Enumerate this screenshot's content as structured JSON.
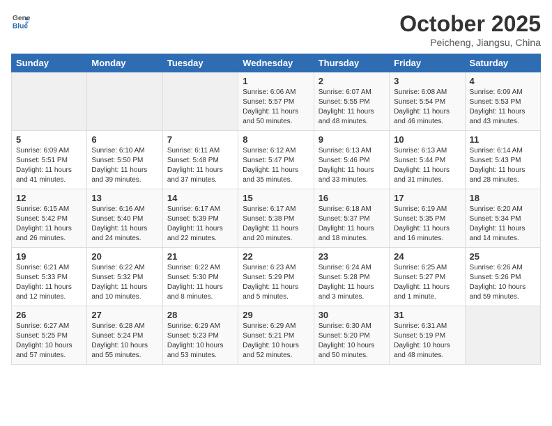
{
  "header": {
    "logo_line1": "General",
    "logo_line2": "Blue",
    "month": "October 2025",
    "location": "Peicheng, Jiangsu, China"
  },
  "weekdays": [
    "Sunday",
    "Monday",
    "Tuesday",
    "Wednesday",
    "Thursday",
    "Friday",
    "Saturday"
  ],
  "weeks": [
    [
      {
        "day": "",
        "info": ""
      },
      {
        "day": "",
        "info": ""
      },
      {
        "day": "",
        "info": ""
      },
      {
        "day": "1",
        "info": "Sunrise: 6:06 AM\nSunset: 5:57 PM\nDaylight: 11 hours\nand 50 minutes."
      },
      {
        "day": "2",
        "info": "Sunrise: 6:07 AM\nSunset: 5:55 PM\nDaylight: 11 hours\nand 48 minutes."
      },
      {
        "day": "3",
        "info": "Sunrise: 6:08 AM\nSunset: 5:54 PM\nDaylight: 11 hours\nand 46 minutes."
      },
      {
        "day": "4",
        "info": "Sunrise: 6:09 AM\nSunset: 5:53 PM\nDaylight: 11 hours\nand 43 minutes."
      }
    ],
    [
      {
        "day": "5",
        "info": "Sunrise: 6:09 AM\nSunset: 5:51 PM\nDaylight: 11 hours\nand 41 minutes."
      },
      {
        "day": "6",
        "info": "Sunrise: 6:10 AM\nSunset: 5:50 PM\nDaylight: 11 hours\nand 39 minutes."
      },
      {
        "day": "7",
        "info": "Sunrise: 6:11 AM\nSunset: 5:48 PM\nDaylight: 11 hours\nand 37 minutes."
      },
      {
        "day": "8",
        "info": "Sunrise: 6:12 AM\nSunset: 5:47 PM\nDaylight: 11 hours\nand 35 minutes."
      },
      {
        "day": "9",
        "info": "Sunrise: 6:13 AM\nSunset: 5:46 PM\nDaylight: 11 hours\nand 33 minutes."
      },
      {
        "day": "10",
        "info": "Sunrise: 6:13 AM\nSunset: 5:44 PM\nDaylight: 11 hours\nand 31 minutes."
      },
      {
        "day": "11",
        "info": "Sunrise: 6:14 AM\nSunset: 5:43 PM\nDaylight: 11 hours\nand 28 minutes."
      }
    ],
    [
      {
        "day": "12",
        "info": "Sunrise: 6:15 AM\nSunset: 5:42 PM\nDaylight: 11 hours\nand 26 minutes."
      },
      {
        "day": "13",
        "info": "Sunrise: 6:16 AM\nSunset: 5:40 PM\nDaylight: 11 hours\nand 24 minutes."
      },
      {
        "day": "14",
        "info": "Sunrise: 6:17 AM\nSunset: 5:39 PM\nDaylight: 11 hours\nand 22 minutes."
      },
      {
        "day": "15",
        "info": "Sunrise: 6:17 AM\nSunset: 5:38 PM\nDaylight: 11 hours\nand 20 minutes."
      },
      {
        "day": "16",
        "info": "Sunrise: 6:18 AM\nSunset: 5:37 PM\nDaylight: 11 hours\nand 18 minutes."
      },
      {
        "day": "17",
        "info": "Sunrise: 6:19 AM\nSunset: 5:35 PM\nDaylight: 11 hours\nand 16 minutes."
      },
      {
        "day": "18",
        "info": "Sunrise: 6:20 AM\nSunset: 5:34 PM\nDaylight: 11 hours\nand 14 minutes."
      }
    ],
    [
      {
        "day": "19",
        "info": "Sunrise: 6:21 AM\nSunset: 5:33 PM\nDaylight: 11 hours\nand 12 minutes."
      },
      {
        "day": "20",
        "info": "Sunrise: 6:22 AM\nSunset: 5:32 PM\nDaylight: 11 hours\nand 10 minutes."
      },
      {
        "day": "21",
        "info": "Sunrise: 6:22 AM\nSunset: 5:30 PM\nDaylight: 11 hours\nand 8 minutes."
      },
      {
        "day": "22",
        "info": "Sunrise: 6:23 AM\nSunset: 5:29 PM\nDaylight: 11 hours\nand 5 minutes."
      },
      {
        "day": "23",
        "info": "Sunrise: 6:24 AM\nSunset: 5:28 PM\nDaylight: 11 hours\nand 3 minutes."
      },
      {
        "day": "24",
        "info": "Sunrise: 6:25 AM\nSunset: 5:27 PM\nDaylight: 11 hours\nand 1 minute."
      },
      {
        "day": "25",
        "info": "Sunrise: 6:26 AM\nSunset: 5:26 PM\nDaylight: 10 hours\nand 59 minutes."
      }
    ],
    [
      {
        "day": "26",
        "info": "Sunrise: 6:27 AM\nSunset: 5:25 PM\nDaylight: 10 hours\nand 57 minutes."
      },
      {
        "day": "27",
        "info": "Sunrise: 6:28 AM\nSunset: 5:24 PM\nDaylight: 10 hours\nand 55 minutes."
      },
      {
        "day": "28",
        "info": "Sunrise: 6:29 AM\nSunset: 5:23 PM\nDaylight: 10 hours\nand 53 minutes."
      },
      {
        "day": "29",
        "info": "Sunrise: 6:29 AM\nSunset: 5:21 PM\nDaylight: 10 hours\nand 52 minutes."
      },
      {
        "day": "30",
        "info": "Sunrise: 6:30 AM\nSunset: 5:20 PM\nDaylight: 10 hours\nand 50 minutes."
      },
      {
        "day": "31",
        "info": "Sunrise: 6:31 AM\nSunset: 5:19 PM\nDaylight: 10 hours\nand 48 minutes."
      },
      {
        "day": "",
        "info": ""
      }
    ]
  ]
}
